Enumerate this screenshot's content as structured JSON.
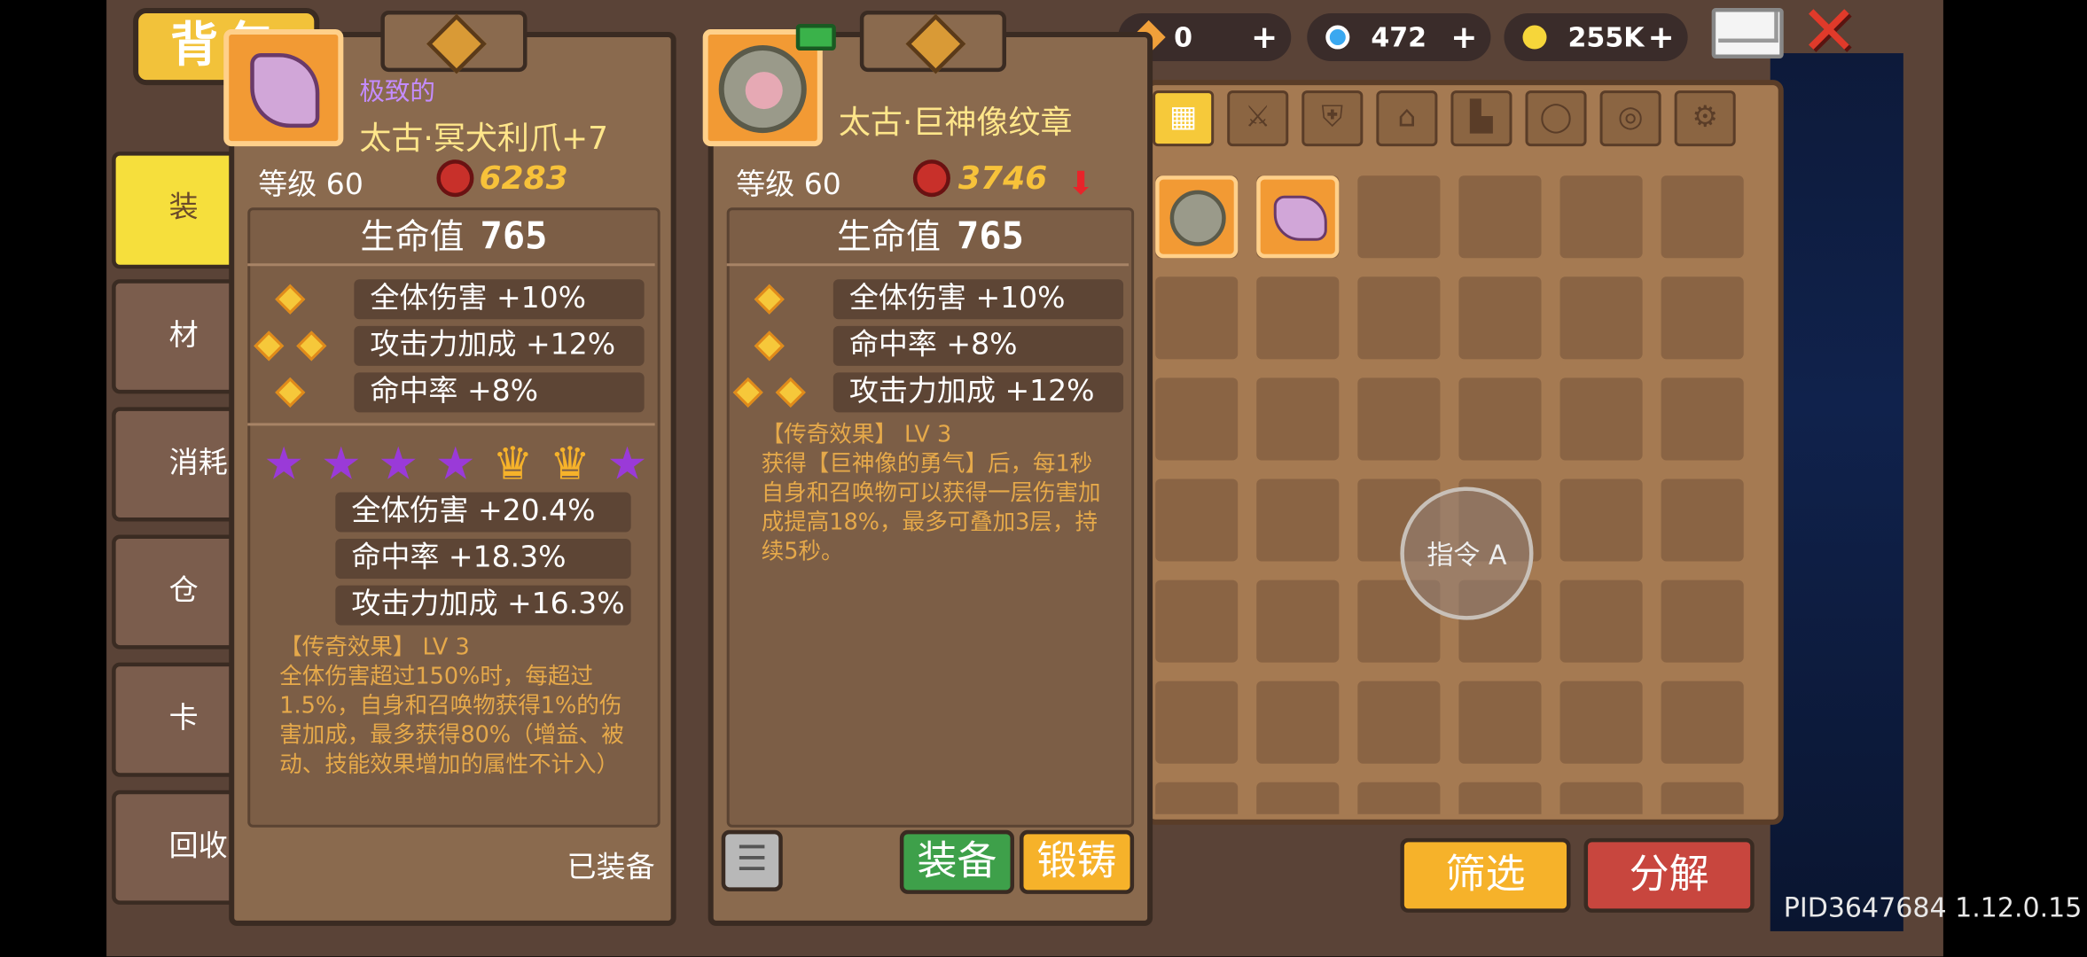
{
  "header": {
    "bag_tab": "背包",
    "currency": [
      {
        "name": "fragment",
        "value": "0",
        "plus": "+",
        "color": "#f0a03a"
      },
      {
        "name": "gem",
        "value": "472",
        "plus": "+",
        "color": "#3aa8f0"
      },
      {
        "name": "gold",
        "value": "255K",
        "plus": "+",
        "color": "#f6d63a"
      }
    ],
    "mail_icon": "envelope-icon",
    "close_icon": "close-icon"
  },
  "sidebar": {
    "items": [
      {
        "label": "装",
        "active": true
      },
      {
        "label": "材",
        "active": false
      },
      {
        "label": "消耗",
        "active": false
      },
      {
        "label": "仓",
        "active": false
      },
      {
        "label": "卡",
        "active": false
      },
      {
        "label": "回收",
        "active": false
      }
    ]
  },
  "category_tabs": [
    "grid-icon",
    "sword-icon",
    "armor-icon",
    "helmet-icon",
    "boots-icon",
    "ring-icon",
    "amulet-icon",
    "gear-icon"
  ],
  "inventory": {
    "command_label": "指令 A",
    "filter_label": "筛选",
    "decompose_label": "分解"
  },
  "card1": {
    "rarity": "极致的",
    "name": "太古·冥犬利爪+7",
    "level": "等级 60",
    "power": "6283",
    "hp_label": "生命值",
    "hp_value": "765",
    "base_stats": [
      {
        "text": "全体伤害 +10%",
        "suns": 1
      },
      {
        "text": "攻击力加成 +12%",
        "suns": 2
      },
      {
        "text": "命中率 +8%",
        "suns": 1
      }
    ],
    "stars": [
      "purple",
      "purple",
      "purple",
      "purple",
      "crown",
      "crown",
      "purple"
    ],
    "bonus_stats": [
      "全体伤害 +20.4%",
      "命中率 +18.3%",
      "攻击力加成 +16.3%"
    ],
    "legend_title": "【传奇效果】 LV 3",
    "legend_desc": "全体伤害超过150%时，每超过1.5%，自身和召唤物获得1%的伤害加成，最多获得80%（增益、被动、技能效果增加的属性不计入）",
    "equipped_label": "已装备"
  },
  "card2": {
    "name": "太古·巨神像纹章",
    "level": "等级 60",
    "power": "3746",
    "power_trend": "down",
    "hp_label": "生命值",
    "hp_value": "765",
    "base_stats": [
      {
        "text": "全体伤害 +10%",
        "suns": 1
      },
      {
        "text": "命中率 +8%",
        "suns": 1
      },
      {
        "text": "攻击力加成 +12%",
        "suns": 2
      }
    ],
    "legend_title": "【传奇效果】 LV 3",
    "legend_desc": "获得【巨神像的勇气】后，每1秒自身和召唤物可以获得一层伤害加成提高18%，最多可叠加3层，持续5秒。",
    "list_icon": "list-icon",
    "equip_label": "装备",
    "forge_label": "锻铸"
  },
  "footer": {
    "pid": "PID3647684 1.12.0.15"
  }
}
